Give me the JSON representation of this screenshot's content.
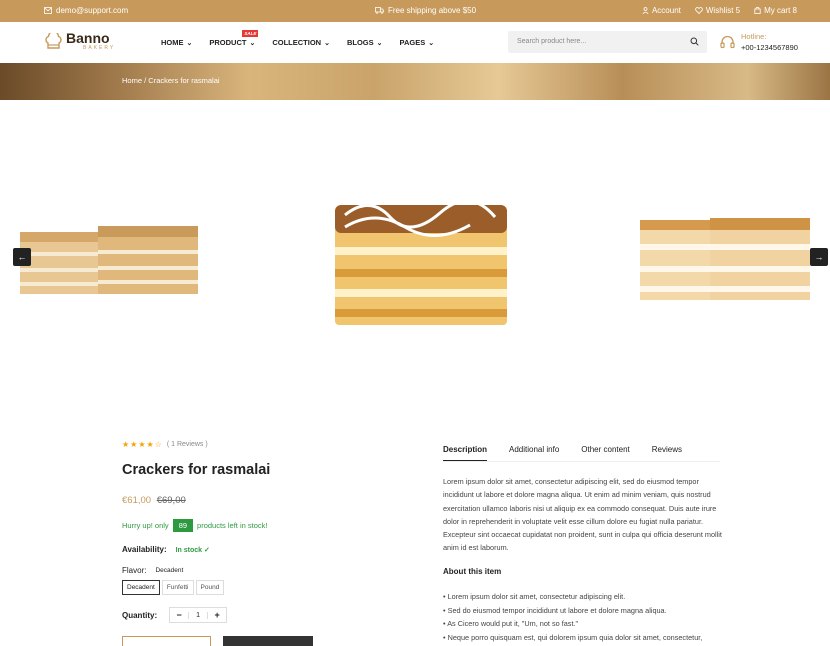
{
  "topbar": {
    "email": "demo@support.com",
    "shipping": "Free shipping above $50",
    "account": "Account",
    "wishlist": "Wishlist 5",
    "cart": "My cart 8"
  },
  "brand": {
    "name": "Banno",
    "tagline": "BAKERY"
  },
  "nav": {
    "items": [
      "HOME",
      "PRODUCT",
      "COLLECTION",
      "BLOGS",
      "PAGES"
    ],
    "sale_badge": "SALE"
  },
  "search": {
    "placeholder": "Search product here..."
  },
  "hotline": {
    "label": "Hotline:",
    "number": "+00-1234567890"
  },
  "breadcrumb": {
    "home": "Home",
    "sep": "/",
    "current": "Crackers for rasmalai"
  },
  "product": {
    "rating": 4,
    "reviews": "( 1 Reviews )",
    "title": "Crackers for rasmalai",
    "price_now": "€61,00",
    "price_old": "€69,00",
    "hurry_pre": "Hurry up! only",
    "stock_count": "89",
    "hurry_post": "products left in stock!",
    "availability_label": "Availability:",
    "availability_value": "In stock",
    "flavor_label": "Flavor:",
    "flavor_value": "Decadent",
    "flavor_options": [
      "Decadent",
      "Funfetti",
      "Pound"
    ],
    "quantity_label": "Quantity:",
    "quantity": "1"
  },
  "tabs": [
    "Description",
    "Additional info",
    "Other content",
    "Reviews"
  ],
  "description": "Lorem ipsum dolor sit amet, consectetur adipiscing elit, sed do eiusmod tempor incididunt ut labore et dolore magna aliqua. Ut enim ad minim veniam, quis nostrud exercitation ullamco laboris nisi ut aliquip ex ea commodo consequat. Duis aute irure dolor in reprehenderit in voluptate velit esse cillum dolore eu fugiat nulla pariatur. Excepteur sint occaecat cupidatat non proident, sunt in culpa qui officia deserunt mollit anim id est laborum.",
  "about": {
    "title": "About this item",
    "bullets": [
      "Lorem ipsum dolor sit amet, consectetur adipiscing elit.",
      "Sed do eiusmod tempor incididunt ut labore et dolore magna aliqua.",
      "As Cicero would put it, \"Um, not so fast.\"",
      "Neque porro quisquam est, qui dolorem ipsum quia dolor sit amet, consectetur,"
    ]
  },
  "colors": {
    "accent": "#c79a5c",
    "sale": "#e53935",
    "stock": "#2e9a40",
    "dark": "#222222"
  }
}
